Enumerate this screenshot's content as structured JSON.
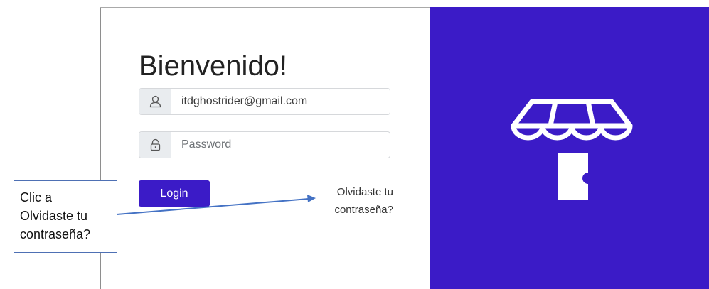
{
  "login": {
    "title": "Bienvenido!",
    "email": {
      "value": "itdghostrider@gmail.com",
      "icon": "user-icon"
    },
    "password": {
      "placeholder": "Password",
      "icon": "lock-icon"
    },
    "login_button": "Login",
    "forgot_password": {
      "line1": "Olvidaste tu",
      "line2": "contraseña?"
    }
  },
  "brand_panel": {
    "icon": "storefront-icon",
    "background": "#3b1bc7"
  },
  "annotation": {
    "lines": [
      "Clic a",
      "Olvidaste tu",
      "contraseña?"
    ],
    "border_color": "#4e70b4",
    "arrow_color": "#4472c4"
  }
}
